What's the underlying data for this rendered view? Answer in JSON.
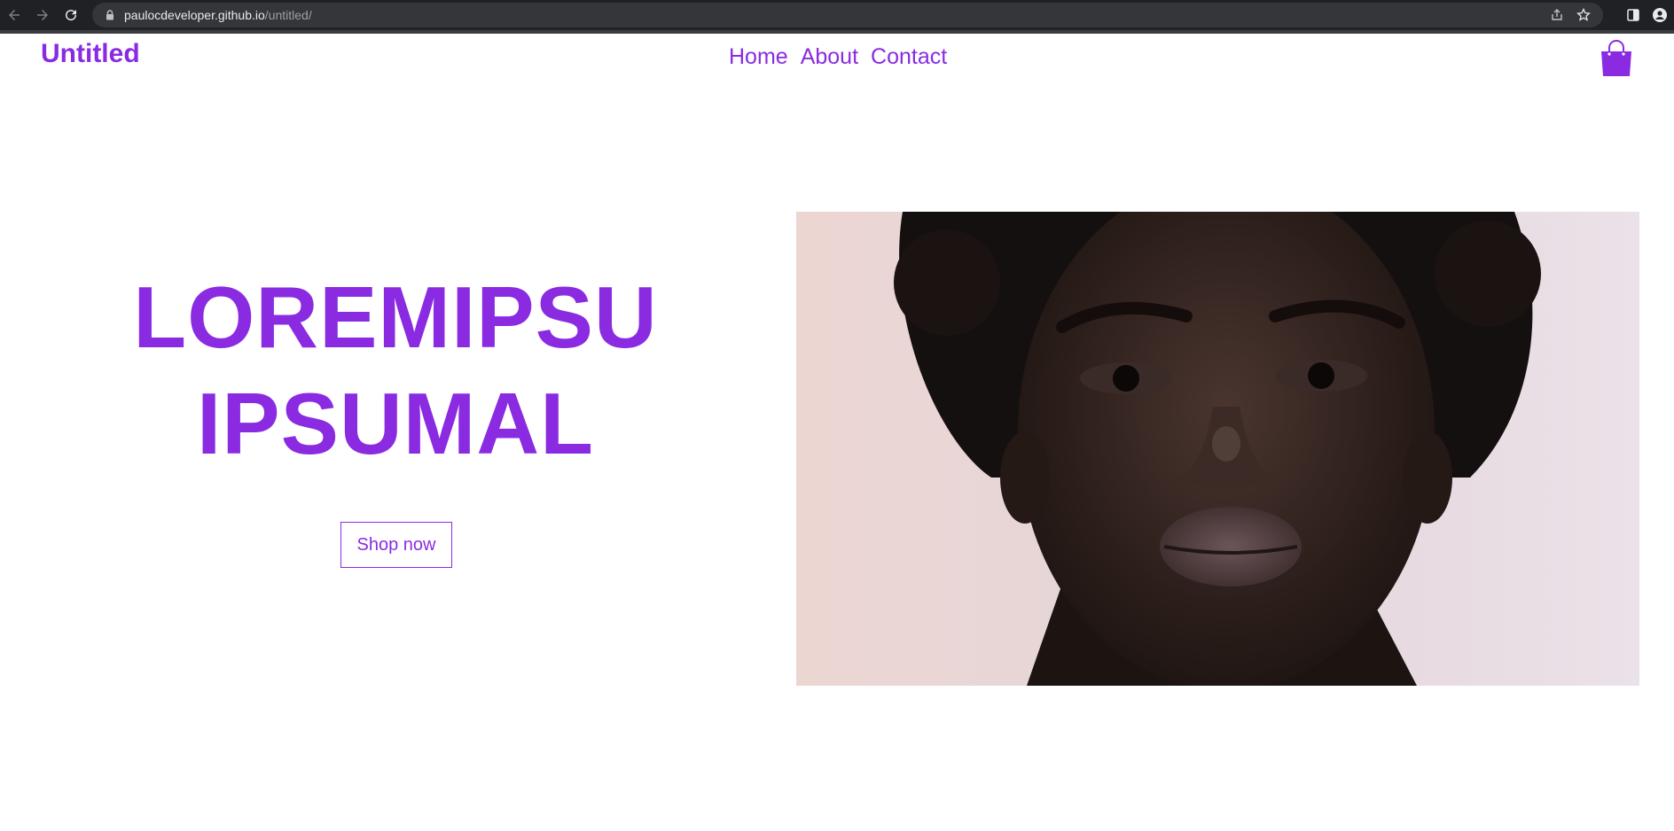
{
  "browser": {
    "url_host": "paulocdeveloper.github.io",
    "url_path": "/untitled/"
  },
  "header": {
    "brand": "Untitled",
    "nav": [
      "Home",
      "About",
      "Contact"
    ],
    "cart_icon": "shopping-bag-icon"
  },
  "hero": {
    "title_line1": "LOREMIPSU",
    "title_line2": "IPSUMAL",
    "cta_label": "Shop now",
    "image": "portrait-photo"
  },
  "colors": {
    "accent": "#8a2be2",
    "chrome_bg": "#202124",
    "omnibox_bg": "#35363a"
  }
}
